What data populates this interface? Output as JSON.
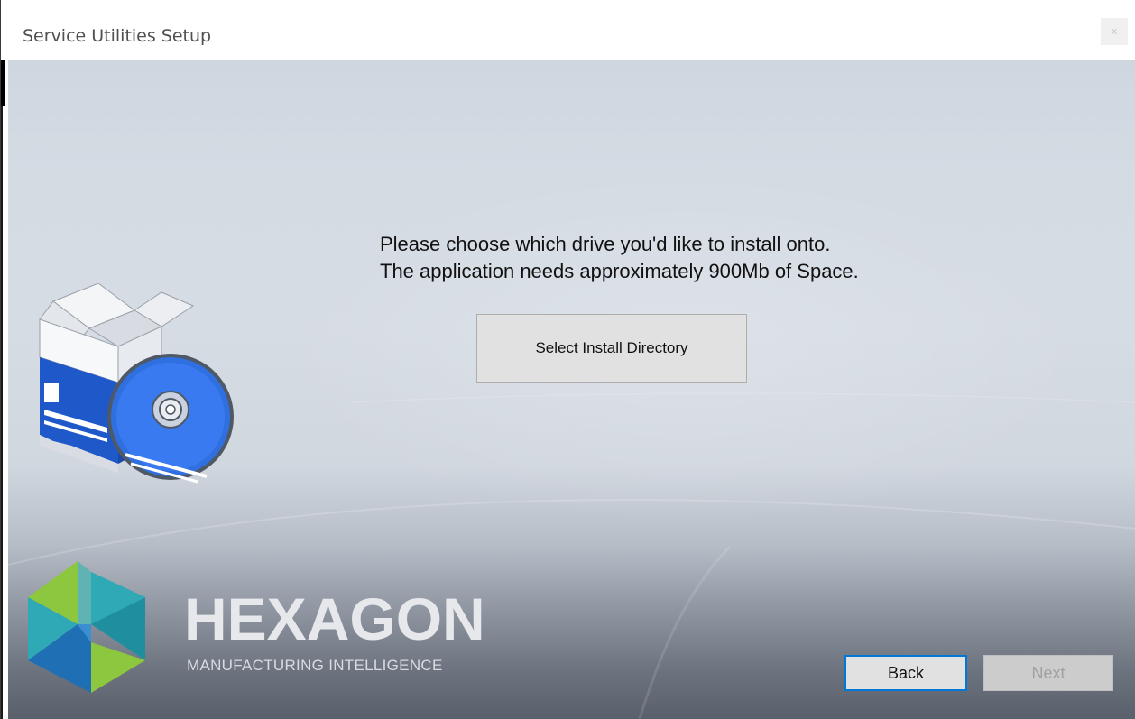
{
  "window": {
    "title": "Service Utilities Setup",
    "close_label": "x"
  },
  "main": {
    "message_line1": "Please choose which drive you'd like to install onto.",
    "message_line2": "The application needs approximately 900Mb of Space.",
    "select_directory_label": "Select Install Directory"
  },
  "branding": {
    "name": "HEXAGON",
    "tagline": "MANUFACTURING INTELLIGENCE",
    "logo_icon": "hexagon-logo-icon",
    "product_icon": "software-box-cd-icon"
  },
  "footer": {
    "back_label": "Back",
    "next_label": "Next",
    "next_enabled": false
  },
  "colors": {
    "focus_border": "#0078d7",
    "logo_green": "#8dc63f",
    "logo_teal": "#2fa9b5",
    "logo_blue": "#1f6fb5",
    "disc_blue": "#2f6fe0"
  }
}
